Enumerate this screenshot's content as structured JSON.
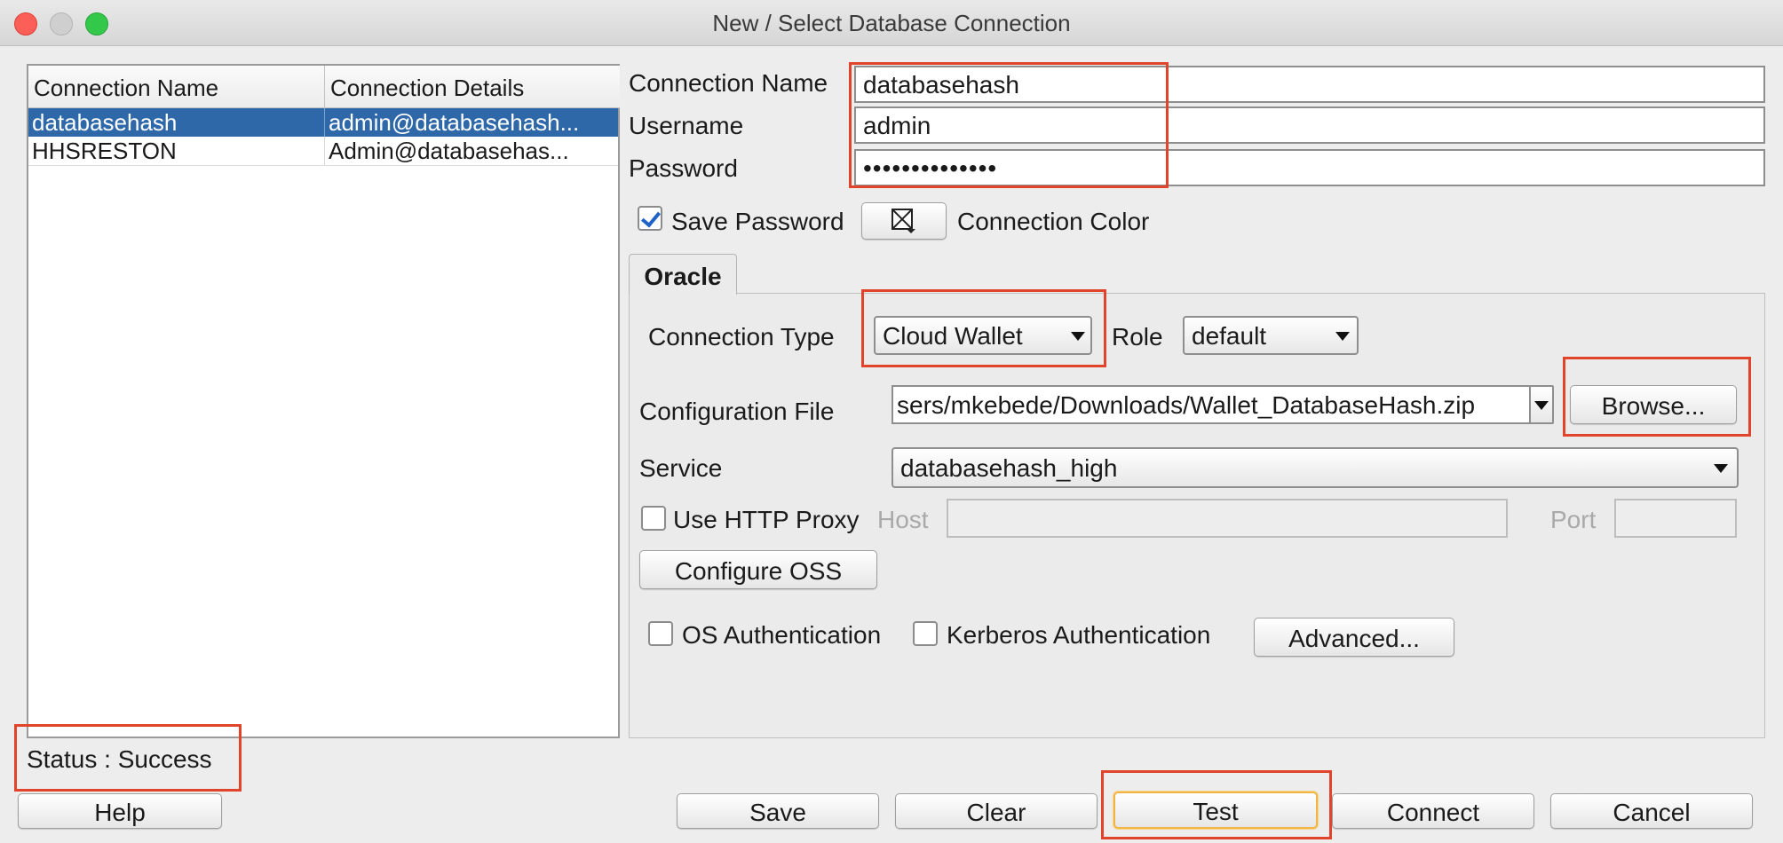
{
  "window": {
    "title": "New / Select Database Connection"
  },
  "connection_list": {
    "columns": [
      "Connection Name",
      "Connection Details"
    ],
    "rows": [
      {
        "name": "databasehash",
        "details": "admin@databasehash..."
      },
      {
        "name": "HHSRESTON",
        "details": "Admin@databasehas..."
      }
    ],
    "selected_index": 0
  },
  "form": {
    "connection_name_label": "Connection Name",
    "connection_name_value": "databasehash",
    "username_label": "Username",
    "username_value": "admin",
    "password_label": "Password",
    "password_value": "••••••••••••••",
    "save_password_label": "Save Password",
    "save_password_checked": true,
    "connection_color_label": "Connection Color"
  },
  "oracle": {
    "tab_label": "Oracle",
    "connection_type_label": "Connection Type",
    "connection_type_value": "Cloud Wallet",
    "role_label": "Role",
    "role_value": "default",
    "config_file_label": "Configuration File",
    "config_file_value": "sers/mkebede/Downloads/Wallet_DatabaseHash.zip",
    "browse_label": "Browse...",
    "service_label": "Service",
    "service_value": "databasehash_high",
    "use_proxy_label": "Use HTTP Proxy",
    "host_label": "Host",
    "port_label": "Port",
    "configure_oss_label": "Configure OSS",
    "os_auth_label": "OS Authentication",
    "kerberos_label": "Kerberos Authentication",
    "advanced_label": "Advanced..."
  },
  "status": {
    "text": "Status : Success"
  },
  "buttons": {
    "help": "Help",
    "save": "Save",
    "clear": "Clear",
    "test": "Test",
    "connect": "Connect",
    "cancel": "Cancel"
  },
  "colors": {
    "selection": "#2e68a8",
    "highlight_box": "#e0452c",
    "default_button_border": "#f0b545"
  }
}
